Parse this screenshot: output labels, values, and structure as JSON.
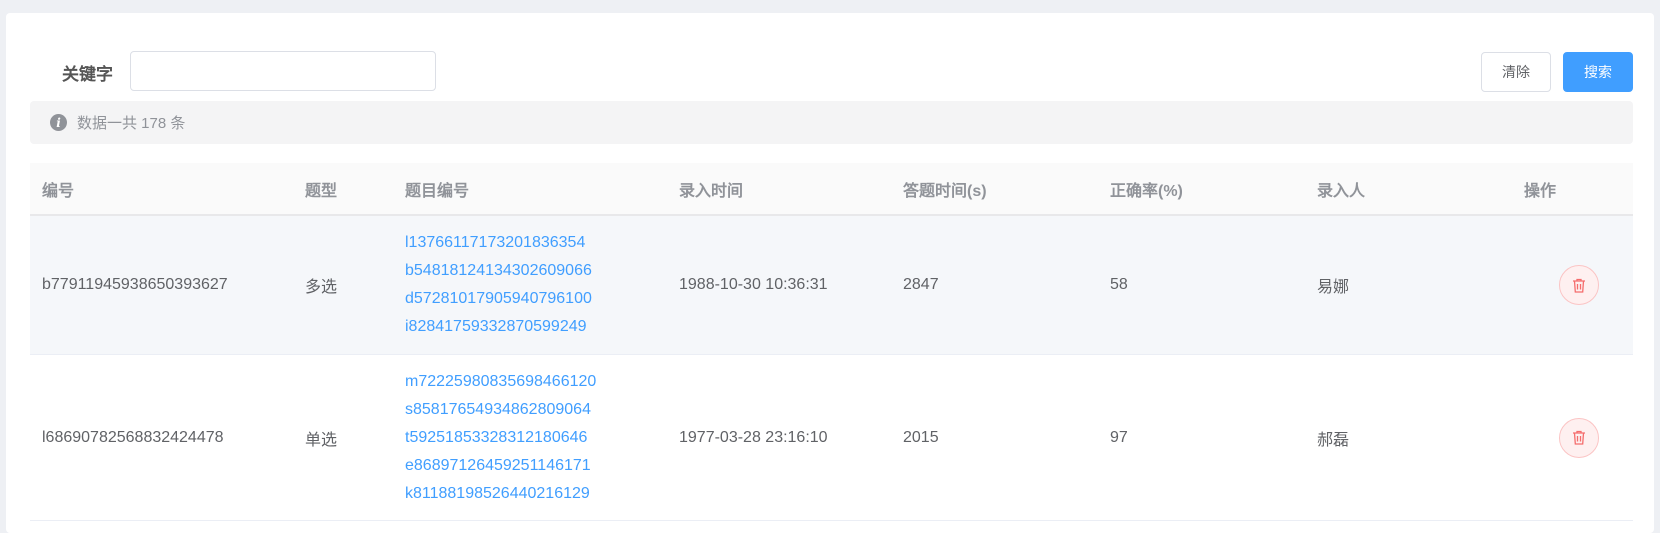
{
  "filter": {
    "keyword_label": "关键字",
    "keyword_value": "",
    "clear_label": "清除",
    "search_label": "搜索"
  },
  "info": {
    "icon": "info-icon",
    "text": "数据一共 178 条"
  },
  "table": {
    "headers": [
      "编号",
      "题型",
      "题目编号",
      "录入时间",
      "答题时间(s)",
      "正确率(%)",
      "录入人",
      "操作"
    ],
    "rows": [
      {
        "id": "b77911945938650393627",
        "type": "多选",
        "question_ids": [
          "l13766117173201836354",
          "b54818124134302609066",
          "d57281017905940796100",
          "i82841759332870599249"
        ],
        "created": "1988-10-30 10:36:31",
        "duration": "2847",
        "accuracy": "58",
        "creator": "易娜"
      },
      {
        "id": "l68690782568832424478",
        "type": "单选",
        "question_ids": [
          "m72225980835698466120",
          "s85817654934862809064",
          "t59251853328312180646",
          "e86897126459251146171",
          "k81188198526440216129"
        ],
        "created": "1977-03-28 23:16:10",
        "duration": "2015",
        "accuracy": "97",
        "creator": "郝磊"
      }
    ]
  },
  "colors": {
    "primary": "#409eff",
    "danger": "#f56c6c",
    "muted": "#909399"
  }
}
